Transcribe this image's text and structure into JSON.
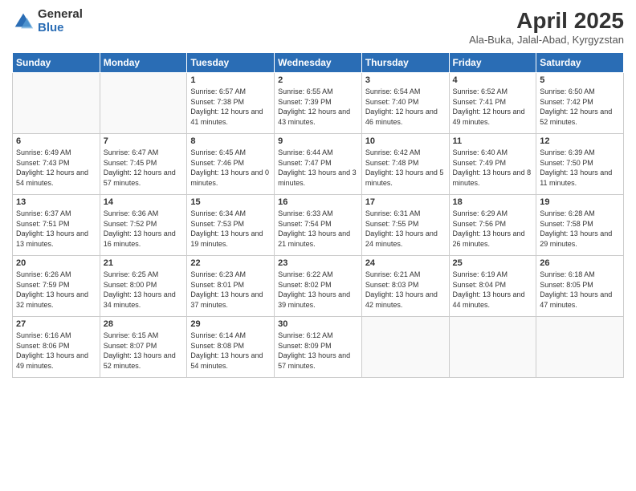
{
  "logo": {
    "general": "General",
    "blue": "Blue"
  },
  "header": {
    "title": "April 2025",
    "subtitle": "Ala-Buka, Jalal-Abad, Kyrgyzstan"
  },
  "weekdays": [
    "Sunday",
    "Monday",
    "Tuesday",
    "Wednesday",
    "Thursday",
    "Friday",
    "Saturday"
  ],
  "weeks": [
    [
      {
        "day": "",
        "sunrise": "",
        "sunset": "",
        "daylight": ""
      },
      {
        "day": "",
        "sunrise": "",
        "sunset": "",
        "daylight": ""
      },
      {
        "day": "1",
        "sunrise": "Sunrise: 6:57 AM",
        "sunset": "Sunset: 7:38 PM",
        "daylight": "Daylight: 12 hours and 41 minutes."
      },
      {
        "day": "2",
        "sunrise": "Sunrise: 6:55 AM",
        "sunset": "Sunset: 7:39 PM",
        "daylight": "Daylight: 12 hours and 43 minutes."
      },
      {
        "day": "3",
        "sunrise": "Sunrise: 6:54 AM",
        "sunset": "Sunset: 7:40 PM",
        "daylight": "Daylight: 12 hours and 46 minutes."
      },
      {
        "day": "4",
        "sunrise": "Sunrise: 6:52 AM",
        "sunset": "Sunset: 7:41 PM",
        "daylight": "Daylight: 12 hours and 49 minutes."
      },
      {
        "day": "5",
        "sunrise": "Sunrise: 6:50 AM",
        "sunset": "Sunset: 7:42 PM",
        "daylight": "Daylight: 12 hours and 52 minutes."
      }
    ],
    [
      {
        "day": "6",
        "sunrise": "Sunrise: 6:49 AM",
        "sunset": "Sunset: 7:43 PM",
        "daylight": "Daylight: 12 hours and 54 minutes."
      },
      {
        "day": "7",
        "sunrise": "Sunrise: 6:47 AM",
        "sunset": "Sunset: 7:45 PM",
        "daylight": "Daylight: 12 hours and 57 minutes."
      },
      {
        "day": "8",
        "sunrise": "Sunrise: 6:45 AM",
        "sunset": "Sunset: 7:46 PM",
        "daylight": "Daylight: 13 hours and 0 minutes."
      },
      {
        "day": "9",
        "sunrise": "Sunrise: 6:44 AM",
        "sunset": "Sunset: 7:47 PM",
        "daylight": "Daylight: 13 hours and 3 minutes."
      },
      {
        "day": "10",
        "sunrise": "Sunrise: 6:42 AM",
        "sunset": "Sunset: 7:48 PM",
        "daylight": "Daylight: 13 hours and 5 minutes."
      },
      {
        "day": "11",
        "sunrise": "Sunrise: 6:40 AM",
        "sunset": "Sunset: 7:49 PM",
        "daylight": "Daylight: 13 hours and 8 minutes."
      },
      {
        "day": "12",
        "sunrise": "Sunrise: 6:39 AM",
        "sunset": "Sunset: 7:50 PM",
        "daylight": "Daylight: 13 hours and 11 minutes."
      }
    ],
    [
      {
        "day": "13",
        "sunrise": "Sunrise: 6:37 AM",
        "sunset": "Sunset: 7:51 PM",
        "daylight": "Daylight: 13 hours and 13 minutes."
      },
      {
        "day": "14",
        "sunrise": "Sunrise: 6:36 AM",
        "sunset": "Sunset: 7:52 PM",
        "daylight": "Daylight: 13 hours and 16 minutes."
      },
      {
        "day": "15",
        "sunrise": "Sunrise: 6:34 AM",
        "sunset": "Sunset: 7:53 PM",
        "daylight": "Daylight: 13 hours and 19 minutes."
      },
      {
        "day": "16",
        "sunrise": "Sunrise: 6:33 AM",
        "sunset": "Sunset: 7:54 PM",
        "daylight": "Daylight: 13 hours and 21 minutes."
      },
      {
        "day": "17",
        "sunrise": "Sunrise: 6:31 AM",
        "sunset": "Sunset: 7:55 PM",
        "daylight": "Daylight: 13 hours and 24 minutes."
      },
      {
        "day": "18",
        "sunrise": "Sunrise: 6:29 AM",
        "sunset": "Sunset: 7:56 PM",
        "daylight": "Daylight: 13 hours and 26 minutes."
      },
      {
        "day": "19",
        "sunrise": "Sunrise: 6:28 AM",
        "sunset": "Sunset: 7:58 PM",
        "daylight": "Daylight: 13 hours and 29 minutes."
      }
    ],
    [
      {
        "day": "20",
        "sunrise": "Sunrise: 6:26 AM",
        "sunset": "Sunset: 7:59 PM",
        "daylight": "Daylight: 13 hours and 32 minutes."
      },
      {
        "day": "21",
        "sunrise": "Sunrise: 6:25 AM",
        "sunset": "Sunset: 8:00 PM",
        "daylight": "Daylight: 13 hours and 34 minutes."
      },
      {
        "day": "22",
        "sunrise": "Sunrise: 6:23 AM",
        "sunset": "Sunset: 8:01 PM",
        "daylight": "Daylight: 13 hours and 37 minutes."
      },
      {
        "day": "23",
        "sunrise": "Sunrise: 6:22 AM",
        "sunset": "Sunset: 8:02 PM",
        "daylight": "Daylight: 13 hours and 39 minutes."
      },
      {
        "day": "24",
        "sunrise": "Sunrise: 6:21 AM",
        "sunset": "Sunset: 8:03 PM",
        "daylight": "Daylight: 13 hours and 42 minutes."
      },
      {
        "day": "25",
        "sunrise": "Sunrise: 6:19 AM",
        "sunset": "Sunset: 8:04 PM",
        "daylight": "Daylight: 13 hours and 44 minutes."
      },
      {
        "day": "26",
        "sunrise": "Sunrise: 6:18 AM",
        "sunset": "Sunset: 8:05 PM",
        "daylight": "Daylight: 13 hours and 47 minutes."
      }
    ],
    [
      {
        "day": "27",
        "sunrise": "Sunrise: 6:16 AM",
        "sunset": "Sunset: 8:06 PM",
        "daylight": "Daylight: 13 hours and 49 minutes."
      },
      {
        "day": "28",
        "sunrise": "Sunrise: 6:15 AM",
        "sunset": "Sunset: 8:07 PM",
        "daylight": "Daylight: 13 hours and 52 minutes."
      },
      {
        "day": "29",
        "sunrise": "Sunrise: 6:14 AM",
        "sunset": "Sunset: 8:08 PM",
        "daylight": "Daylight: 13 hours and 54 minutes."
      },
      {
        "day": "30",
        "sunrise": "Sunrise: 6:12 AM",
        "sunset": "Sunset: 8:09 PM",
        "daylight": "Daylight: 13 hours and 57 minutes."
      },
      {
        "day": "",
        "sunrise": "",
        "sunset": "",
        "daylight": ""
      },
      {
        "day": "",
        "sunrise": "",
        "sunset": "",
        "daylight": ""
      },
      {
        "day": "",
        "sunrise": "",
        "sunset": "",
        "daylight": ""
      }
    ]
  ]
}
